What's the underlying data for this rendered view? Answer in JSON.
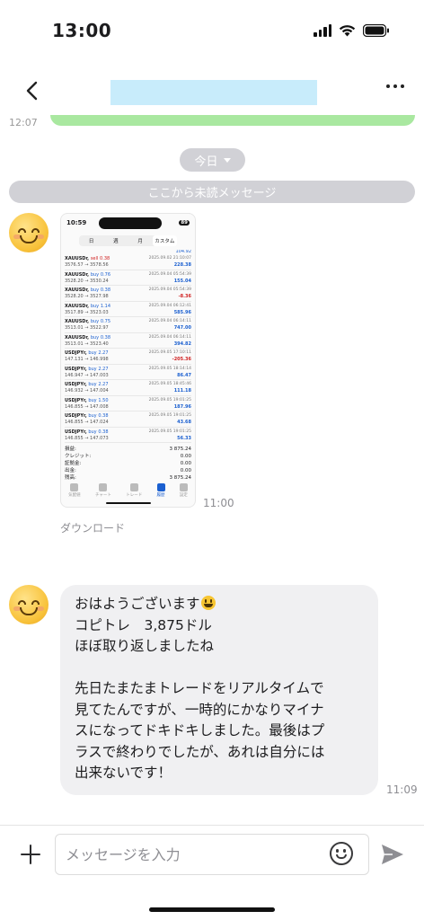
{
  "status_bar": {
    "time": "13:00"
  },
  "header": {
    "title_redacted": ""
  },
  "chat": {
    "prev_time": "12:07",
    "date_pill": "今日",
    "unread_banner": "ここから未読メッセージ",
    "image_message": {
      "time": "11:00",
      "download_label": "ダウンロード",
      "screenshot": {
        "status_time": "10:59",
        "battery": "89",
        "tabs": [
          "日",
          "週",
          "月",
          "カスタム"
        ],
        "selected_tab": "カスタム",
        "top_partial_value": "104.92",
        "trades": [
          {
            "symbol": "XAUUSDr,",
            "side": "sell",
            "lots": "0.38",
            "prices": "3576.57 → 3578.56",
            "date": "2025.09.02 21:10:07",
            "profit": "228.38",
            "sign": "pos"
          },
          {
            "symbol": "XAUUSDr,",
            "side": "buy",
            "lots": "0.76",
            "prices": "3528.20 → 3530.24",
            "date": "2025.09.04 05:54:39",
            "profit": "155.04",
            "sign": "pos"
          },
          {
            "symbol": "XAUUSDr,",
            "side": "buy",
            "lots": "0.38",
            "prices": "3528.20 → 3527.98",
            "date": "2025.09.04 05:54:39",
            "profit": "-8.36",
            "sign": "neg"
          },
          {
            "symbol": "XAUUSDr,",
            "side": "buy",
            "lots": "1.14",
            "prices": "3517.89 → 3523.03",
            "date": "2025.09.04 06:12:41",
            "profit": "585.96",
            "sign": "pos"
          },
          {
            "symbol": "XAUUSDr,",
            "side": "buy",
            "lots": "0.75",
            "prices": "3513.01 → 3522.97",
            "date": "2025.09.04 06:14:11",
            "profit": "747.00",
            "sign": "pos"
          },
          {
            "symbol": "XAUUSDr,",
            "side": "buy",
            "lots": "0.38",
            "prices": "3513.01 → 3523.40",
            "date": "2025.09.04 06:14:11",
            "profit": "394.82",
            "sign": "pos"
          },
          {
            "symbol": "USDJPYr,",
            "side": "buy",
            "lots": "2.27",
            "prices": "147.131 → 146.998",
            "date": "2025.09.05 17:10:11",
            "profit": "-205.36",
            "sign": "neg"
          },
          {
            "symbol": "USDJPYr,",
            "side": "buy",
            "lots": "2.27",
            "prices": "146.947 → 147.003",
            "date": "2025.09.05 18:14:14",
            "profit": "86.47",
            "sign": "pos"
          },
          {
            "symbol": "USDJPYr,",
            "side": "buy",
            "lots": "2.27",
            "prices": "146.932 → 147.004",
            "date": "2025.09.05 18:45:46",
            "profit": "111.18",
            "sign": "pos"
          },
          {
            "symbol": "USDJPYr,",
            "side": "buy",
            "lots": "1.50",
            "prices": "146.855 → 147.008",
            "date": "2025.09.05 19:01:25",
            "profit": "187.96",
            "sign": "pos"
          },
          {
            "symbol": "USDJPYr,",
            "side": "buy",
            "lots": "0.38",
            "prices": "146.855 → 147.024",
            "date": "2025.09.05 19:01:25",
            "profit": "43.68",
            "sign": "pos"
          },
          {
            "symbol": "USDJPYr,",
            "side": "buy",
            "lots": "0.38",
            "prices": "146.855 → 147.073",
            "date": "2025.09.05 19:01:25",
            "profit": "56.33",
            "sign": "pos"
          }
        ],
        "summary": [
          {
            "label": "損益:",
            "value": "3 875.24"
          },
          {
            "label": "クレジット:",
            "value": "0.00"
          },
          {
            "label": "証拠金:",
            "value": "0.00"
          },
          {
            "label": "出金:",
            "value": "0.00"
          },
          {
            "label": "残高:",
            "value": "3 875.24"
          }
        ],
        "nav": [
          "気配値",
          "チャート",
          "トレード",
          "履歴",
          "設定"
        ],
        "nav_active": "履歴"
      }
    },
    "text_message": {
      "time": "11:09",
      "lines": [
        "おはようございます",
        "コピトレ　3,875ドル",
        "ほぼ取り返しましたね",
        "",
        "先日たまたまトレードをリアルタイムで",
        "見てたんですが、一時的にかなりマイナ",
        "スになってドキドキしました。最後はプ",
        "ラスで終わりでしたが、あれは自分には",
        "出来ないです！"
      ]
    }
  },
  "input_bar": {
    "placeholder": "メッセージを入力"
  }
}
